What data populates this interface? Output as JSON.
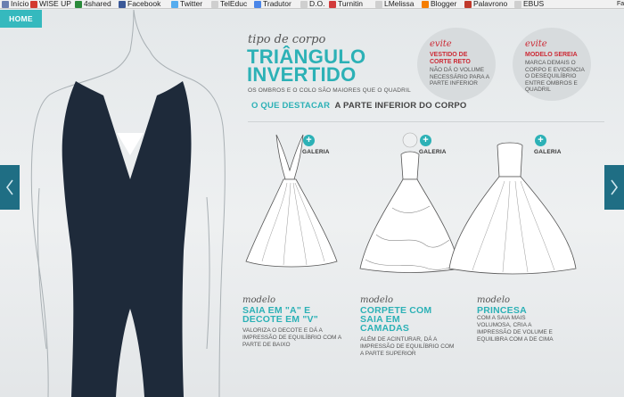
{
  "bookmarks": [
    {
      "label": "Início",
      "icon": "start-icon",
      "color": "#6a7fb0"
    },
    {
      "label": "WISE UP",
      "icon": "wiseup-icon",
      "color": "#d33a2f"
    },
    {
      "label": "4shared",
      "icon": "4shared-icon",
      "color": "#2a8a3a"
    },
    {
      "label": "Facebook",
      "icon": "facebook-icon",
      "color": "#3b5998"
    },
    {
      "label": "Twitter",
      "icon": "twitter-icon",
      "color": "#55acee"
    },
    {
      "label": "TelEduc",
      "icon": "page-icon",
      "color": "#cfcfcf"
    },
    {
      "label": "Tradutor",
      "icon": "translate-icon",
      "color": "#4a86e8"
    },
    {
      "label": "D.O.",
      "icon": "page-icon",
      "color": "#cfcfcf"
    },
    {
      "label": "Turnitin",
      "icon": "turnitin-icon",
      "color": "#d23b3b"
    },
    {
      "label": "LMelissa",
      "icon": "page-icon",
      "color": "#cfcfcf"
    },
    {
      "label": "Blogger",
      "icon": "blogger-icon",
      "color": "#f57d00"
    },
    {
      "label": "Palavrono",
      "icon": "palavrono-icon",
      "color": "#c0392b"
    },
    {
      "label": "EBUS",
      "icon": "page-icon",
      "color": "#cfcfcf"
    }
  ],
  "bookmarks_overflow": "Fav",
  "home_label": "HOME",
  "title": {
    "kicker": "tipo de corpo",
    "main_line1": "TRIÂNGULO",
    "main_line2": "INVERTIDO",
    "subtitle": "OS OMBROS E O COLO SÃO MAIORES QUE O QUADRIL"
  },
  "highlight": {
    "part_a": "O QUE DESTACAR",
    "part_b": "A PARTE INFERIOR DO CORPO"
  },
  "avoid": [
    {
      "head": "evite",
      "title": "VESTIDO DE CORTE RETO",
      "text": "NÃO DÁ O VOLUME NECESSÁRIO PARA A PARTE INFERIOR"
    },
    {
      "head": "evite",
      "title": "MODELO SEREIA",
      "text": "MARCA DEMAIS O CORPO E EVIDENCIA O DESEQUILÍBRIO ENTRE OMBROS E QUADRIL"
    }
  ],
  "gallery_label": "GALERIA",
  "plus_glyph": "+",
  "models": [
    {
      "kicker": "modelo",
      "title_line1": "SAIA EM \"A\" E",
      "title_line2": "DECOTE EM \"V\"",
      "title_line3": "",
      "desc": "VALORIZA O DECOTE E DÁ A IMPRESSÃO DE EQUILÍBRIO COM A PARTE DE BAIXO"
    },
    {
      "kicker": "modelo",
      "title_line1": "CORPETE COM",
      "title_line2": "SAIA EM",
      "title_line3": "CAMADAS",
      "desc": "ALÉM DE ACINTURAR, DÁ A IMPRESSÃO DE EQUILÍBRIO COM A PARTE SUPERIOR"
    },
    {
      "kicker": "modelo",
      "title_line1": "PRINCESA",
      "title_line2": "",
      "title_line3": "",
      "desc": "COM A SAIA MAIS VOLUMOSA, CRIA A IMPRESSÃO DE VOLUME E EQUILIBRA COM A DE CIMA"
    }
  ],
  "colors": {
    "accent": "#2cb1b6",
    "nav": "#1f6e84",
    "avoid_red": "#cc2a35",
    "bodysuit": "#1e2a3a"
  }
}
